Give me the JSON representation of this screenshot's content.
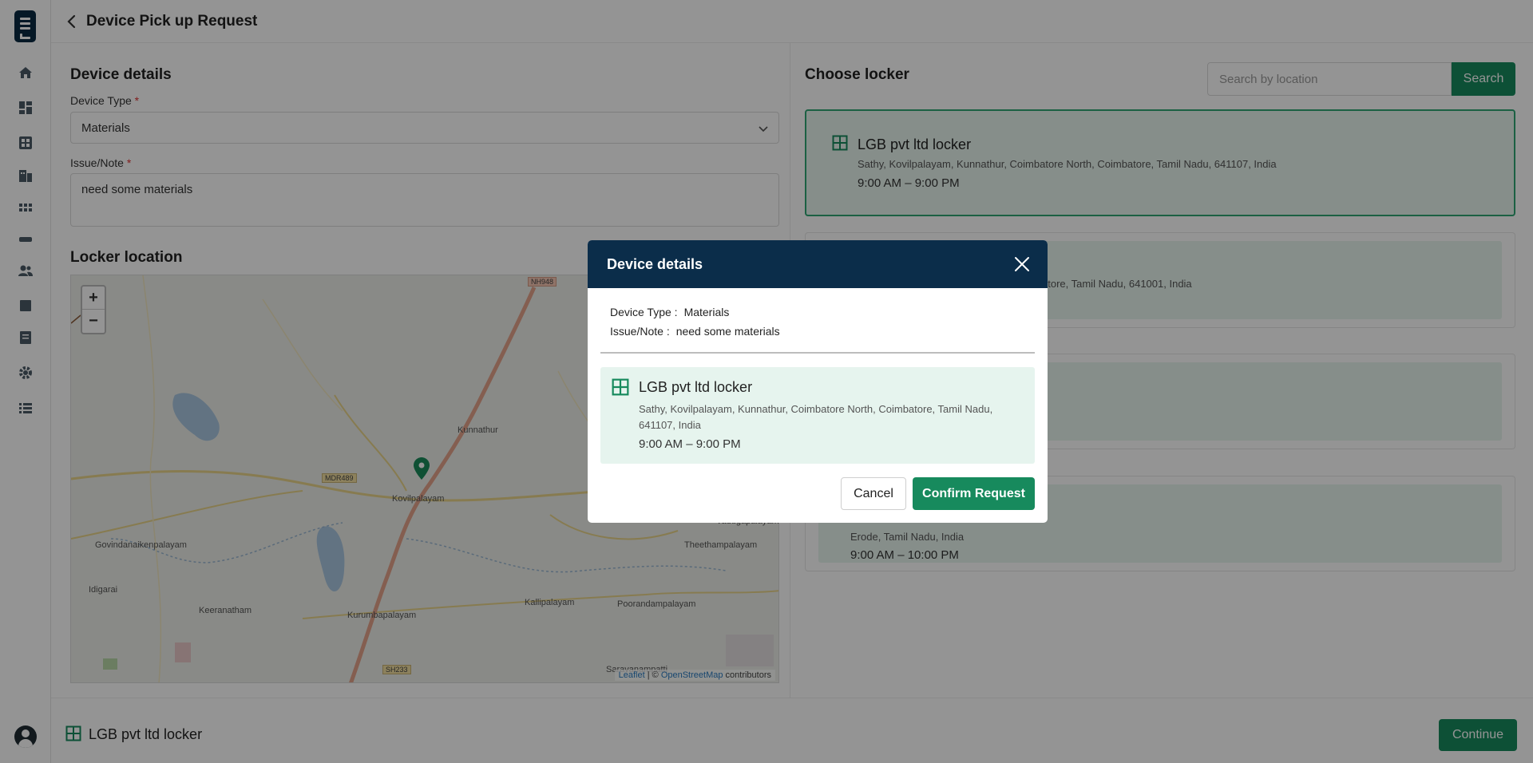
{
  "header": {
    "title": "Device Pick up Request"
  },
  "sidebar": {
    "icons": [
      "home-icon",
      "dashboard-icon",
      "devices-icon",
      "building-icon",
      "grid-icon",
      "card-icon",
      "users-icon",
      "box-icon",
      "report-icon",
      "settings-icon",
      "list-icon"
    ]
  },
  "device_details": {
    "title": "Device details",
    "device_type_label": "Device Type",
    "device_type_value": "Materials",
    "issue_label": "Issue/Note",
    "issue_value": "need some materials",
    "required_mark": "*"
  },
  "locker_location": {
    "title": "Locker location",
    "zoom_in": "+",
    "zoom_out": "−",
    "labels": {
      "kunnathur": "Kunnathur",
      "kovilpalayam": "Kovilpalayam",
      "govindanaikenpalayam": "Govindanaikenpalayam",
      "idigarai": "Idigarai",
      "keeranatham": "Keeranatham",
      "kurumbapalayam": "Kurumbapalayam",
      "kallipalayam": "Kallipalayam",
      "poorandampalayam": "Poorandampalayam",
      "theethampalayam": "Theethampalayam",
      "vadugapalayam": "Vadugapalayam",
      "saravanampatti": "Saravanampatti"
    },
    "roads": {
      "nh948": "NH948",
      "mdr489": "MDR489",
      "sh233": "SH233"
    },
    "attribution_leaflet": "Leaflet",
    "attribution_sep": " | © ",
    "attribution_osm": "OpenStreetMap",
    "attribution_tail": " contributors"
  },
  "choose_locker": {
    "title": "Choose locker",
    "search_placeholder": "Search by location",
    "search_label": "Search",
    "lockers": [
      {
        "name": "LGB pvt ltd locker",
        "address": "Sathy, Kovilpalayam, Kunnathur, Coimbatore North, Coimbatore, Tamil Nadu, 641107, India",
        "hours": "9:00 AM – 9:00 PM"
      },
      {
        "address": "atore, Tamil Nadu, 641001, India"
      },
      {
        "address": "Erode, Tamil Nadu, India",
        "hours": "9:00 AM – 10:00 PM"
      }
    ]
  },
  "footer": {
    "selected_locker": "LGB pvt ltd locker",
    "continue_label": "Continue"
  },
  "modal": {
    "title": "Device details",
    "device_type_key": "Device Type :",
    "device_type_value": "Materials",
    "issue_key": "Issue/Note :",
    "issue_value": "need some materials",
    "locker_name": "LGB pvt ltd locker",
    "locker_address": "Sathy, Kovilpalayam, Kunnathur, Coimbatore North, Coimbatore, Tamil Nadu, 641107, India",
    "locker_hours": "9:00 AM – 9:00 PM",
    "cancel_label": "Cancel",
    "confirm_label": "Confirm Request"
  },
  "colors": {
    "brand_navy": "#0b2d4a",
    "accent_green": "#178a5d",
    "selected_bg": "#e6f4ee"
  }
}
